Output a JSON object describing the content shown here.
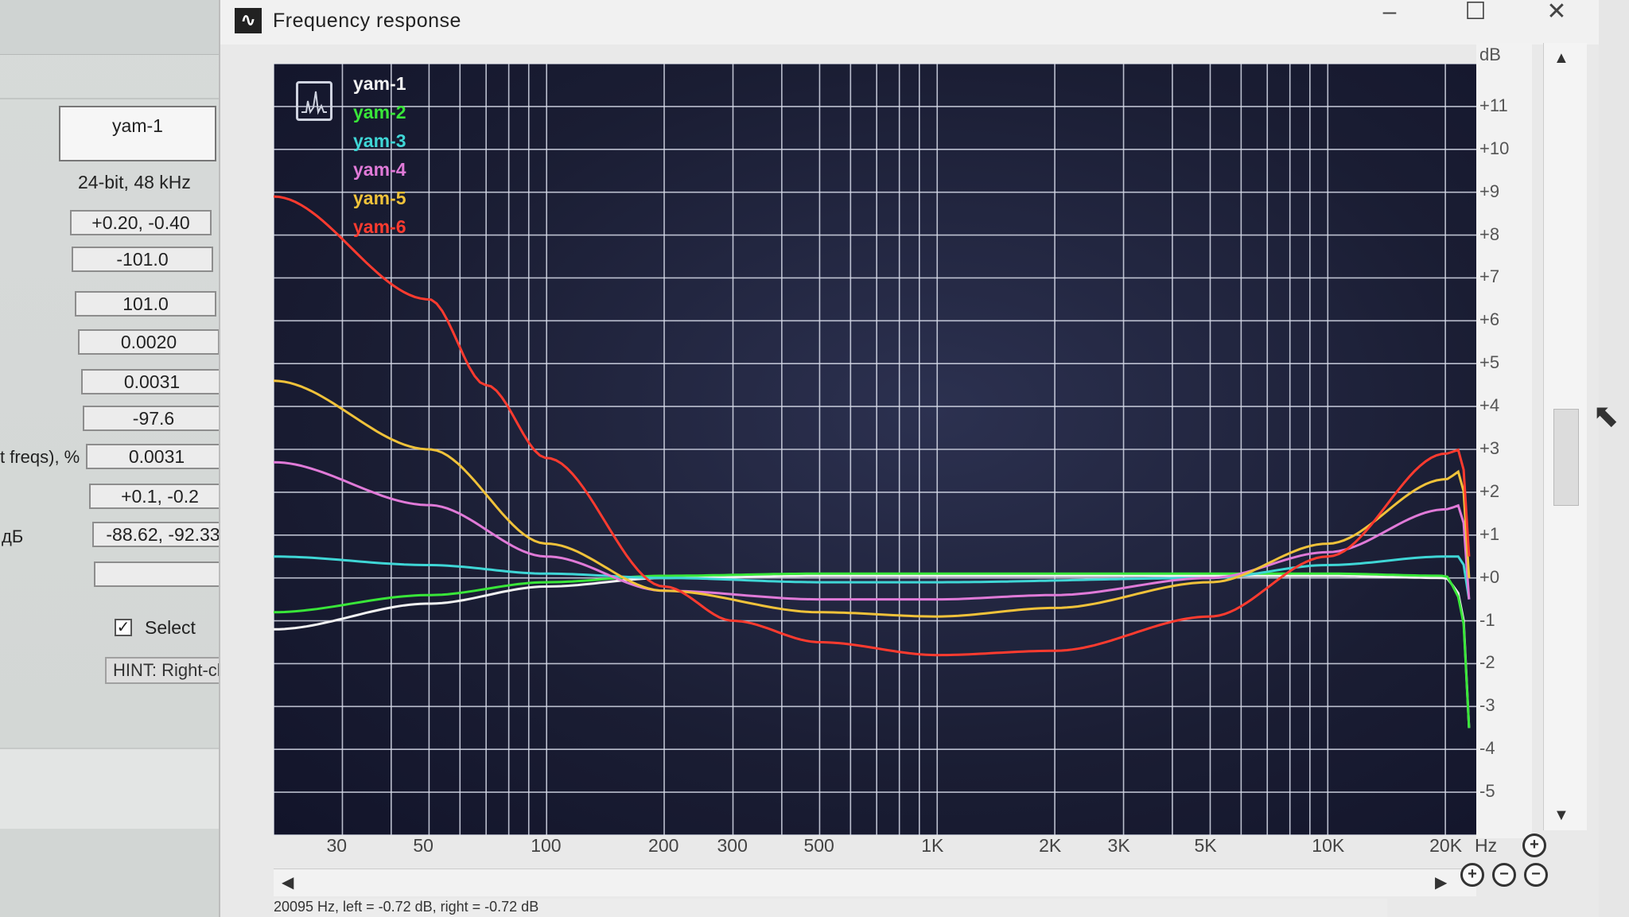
{
  "left_panel": {
    "file_name": "yam-1",
    "format": "24-bit, 48 kHz",
    "fields": [
      "+0.20, -0.40",
      "-101.0",
      "101.0",
      "0.0020",
      "0.0031",
      "-97.6",
      "0.0031",
      "+0.1, -0.2",
      "-88.62, -92.33",
      ""
    ],
    "label_freqs": "t freqs), %",
    "label_db": "дБ",
    "select_checked": "✓",
    "select_label": "Select",
    "hint": "HINT: Right-click"
  },
  "window": {
    "title": "Frequency response",
    "icon": "waveform-icon"
  },
  "chart_data": {
    "type": "line",
    "xlabel": "Hz",
    "ylabel": "dB",
    "x_scale": "log",
    "xlim": [
      20,
      24000
    ],
    "ylim": [
      -6,
      12
    ],
    "grid": true,
    "legend_position": "top-left",
    "x_tick_labels": [
      "30",
      "50",
      "100",
      "200",
      "300",
      "500",
      "1K",
      "2K",
      "3K",
      "5K",
      "10K",
      "20K"
    ],
    "x_ticks": [
      30,
      50,
      100,
      200,
      300,
      500,
      1000,
      2000,
      3000,
      5000,
      10000,
      20000
    ],
    "y_tick_labels": [
      "+11",
      "+10",
      "+9",
      "+8",
      "+7",
      "+6",
      "+5",
      "+4",
      "+3",
      "+2",
      "+1",
      "+0",
      "-1",
      "-2",
      "-3",
      "-4",
      "-5"
    ],
    "y_ticks": [
      11,
      10,
      9,
      8,
      7,
      6,
      5,
      4,
      3,
      2,
      1,
      0,
      -1,
      -2,
      -3,
      -4,
      -5
    ],
    "series": [
      {
        "name": "yam-1",
        "color": "#f2f2f2",
        "x": [
          20,
          50,
          100,
          200,
          500,
          1000,
          5000,
          10000,
          20000,
          22000,
          23000
        ],
        "y": [
          -1.2,
          -0.6,
          -0.2,
          0.0,
          0.05,
          0.05,
          0.05,
          0.05,
          0.0,
          -0.4,
          -3.5
        ]
      },
      {
        "name": "yam-2",
        "color": "#39e639",
        "x": [
          20,
          50,
          100,
          200,
          500,
          1000,
          5000,
          10000,
          20000,
          22000,
          23000
        ],
        "y": [
          -0.8,
          -0.4,
          -0.1,
          0.05,
          0.1,
          0.1,
          0.1,
          0.1,
          0.05,
          -0.5,
          -3.5
        ]
      },
      {
        "name": "yam-3",
        "color": "#3fd6d6",
        "x": [
          20,
          50,
          100,
          200,
          500,
          1000,
          5000,
          10000,
          20000,
          22000,
          23000
        ],
        "y": [
          0.5,
          0.3,
          0.1,
          0.0,
          -0.1,
          -0.1,
          0.0,
          0.3,
          0.5,
          0.5,
          -0.5
        ]
      },
      {
        "name": "yam-4",
        "color": "#e07ad8",
        "x": [
          20,
          50,
          100,
          200,
          500,
          1000,
          2000,
          5000,
          10000,
          20000,
          22000,
          23000
        ],
        "y": [
          2.7,
          1.7,
          0.5,
          -0.3,
          -0.5,
          -0.5,
          -0.4,
          0.0,
          0.6,
          1.6,
          1.7,
          -0.5
        ]
      },
      {
        "name": "yam-5",
        "color": "#f0c23a",
        "x": [
          20,
          50,
          100,
          200,
          500,
          1000,
          2000,
          5000,
          10000,
          20000,
          22000,
          23000
        ],
        "y": [
          4.6,
          3.0,
          0.8,
          -0.3,
          -0.8,
          -0.9,
          -0.7,
          -0.1,
          0.8,
          2.3,
          2.5,
          0.0
        ]
      },
      {
        "name": "yam-6",
        "color": "#ff3b2f",
        "x": [
          20,
          50,
          70,
          100,
          200,
          300,
          500,
          1000,
          2000,
          5000,
          10000,
          20000,
          22000,
          23000
        ],
        "y": [
          8.9,
          6.5,
          4.5,
          2.8,
          -0.2,
          -1.0,
          -1.5,
          -1.8,
          -1.7,
          -0.9,
          0.5,
          2.9,
          3.0,
          0.5
        ]
      }
    ]
  },
  "axis": {
    "db_unit": "dB",
    "hz_unit": "Hz"
  },
  "statusbar": {
    "text": "20095 Hz, left = -0.72 dB, right = -0.72 dB"
  }
}
